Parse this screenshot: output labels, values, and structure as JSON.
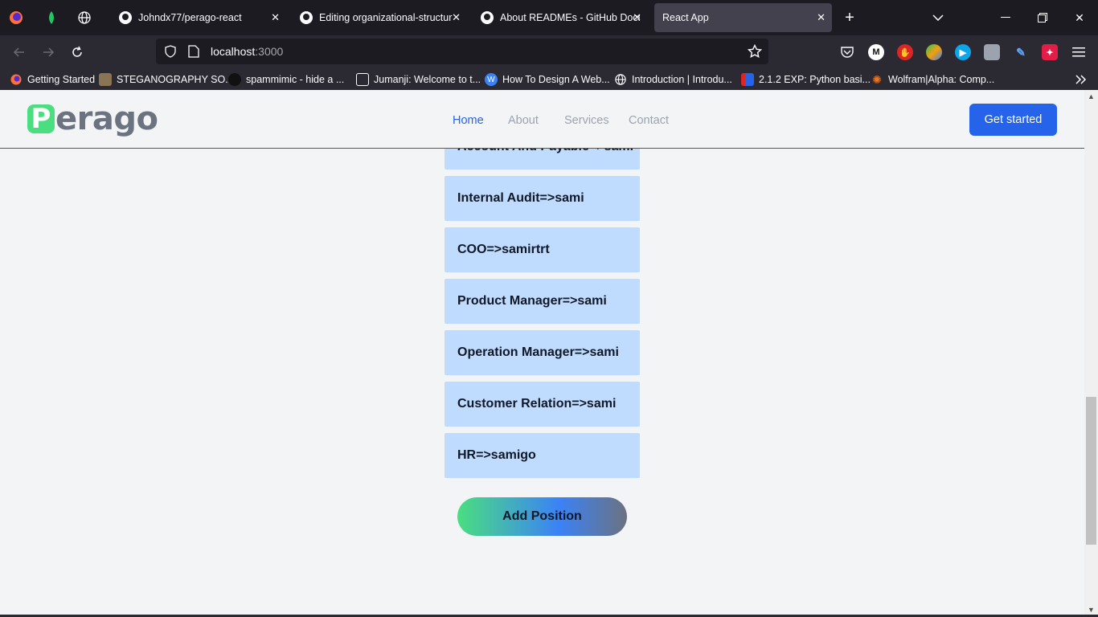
{
  "browser": {
    "tabs": [
      {
        "label": "Johndx77/perago-react"
      },
      {
        "label": "Editing organizational-structure"
      },
      {
        "label": "About READMEs - GitHub Docs"
      },
      {
        "label": "React App"
      }
    ],
    "url": {
      "host": "localhost",
      "port": ":3000"
    },
    "bookmarks": [
      {
        "label": "Getting Started"
      },
      {
        "label": "STEGANOGRAPHY SO..."
      },
      {
        "label": "spammimic - hide a ..."
      },
      {
        "label": "Jumanji: Welcome to t..."
      },
      {
        "label": "How To Design A Web..."
      },
      {
        "label": "Introduction | Introdu..."
      },
      {
        "label": "2.1.2 EXP: Python basi..."
      },
      {
        "label": "Wolfram|Alpha: Comp..."
      }
    ]
  },
  "site": {
    "logo_p": "P",
    "logo_rest": "erago",
    "nav": [
      {
        "label": "Home"
      },
      {
        "label": "About"
      },
      {
        "label": "Services"
      },
      {
        "label": "Contact"
      }
    ],
    "cta": "Get started"
  },
  "positions": [
    {
      "label": "Account And Payable=>sami"
    },
    {
      "label": "Internal Audit=>sami"
    },
    {
      "label": "COO=>samirtrt"
    },
    {
      "label": "Product Manager=>sami"
    },
    {
      "label": "Operation Manager=>sami"
    },
    {
      "label": "Customer Relation=>sami"
    },
    {
      "label": "HR=>samigo"
    }
  ],
  "add_button": "Add Position",
  "colors": {
    "accent": "#2563eb",
    "card": "#bfdbfe",
    "brand_green": "#4ade80"
  }
}
